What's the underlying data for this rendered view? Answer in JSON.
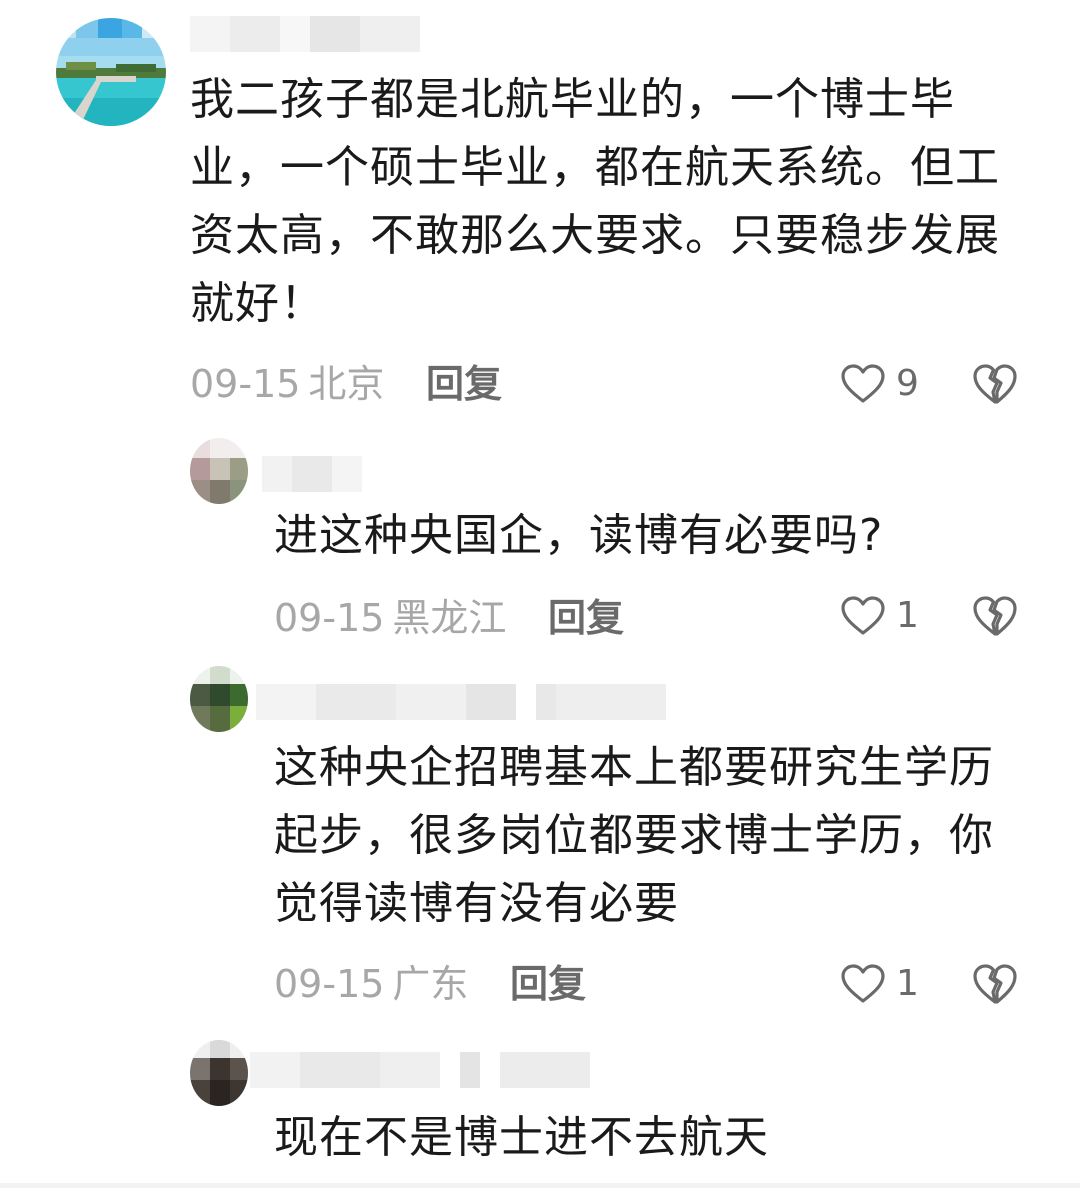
{
  "comments": [
    {
      "text": "我二孩子都是北航毕业的，一个博士毕业，一个硕士毕业，都在航天系统。但工资太高，不敢那么大要求。只要稳步发展就好！",
      "date": "09-15",
      "location": "北京",
      "reply_label": "回复",
      "likes": "9"
    },
    {
      "text": "进这种央国企，读博有必要吗?",
      "date": "09-15",
      "location": "黑龙江",
      "reply_label": "回复",
      "likes": "1"
    },
    {
      "text": "这种央企招聘基本上都要研究生学历起步，很多岗位都要求博士学历，你觉得读博有没有必要",
      "date": "09-15",
      "location": "广东",
      "reply_label": "回复",
      "likes": "1"
    },
    {
      "text": "现在不是博士进不去航天"
    }
  ],
  "colors": {
    "text": "#1a1a1a",
    "meta": "#a7a7a7",
    "action": "#6a6a6a"
  },
  "icons": {
    "like": "heart-outline-icon",
    "dislike": "broken-heart-icon"
  }
}
